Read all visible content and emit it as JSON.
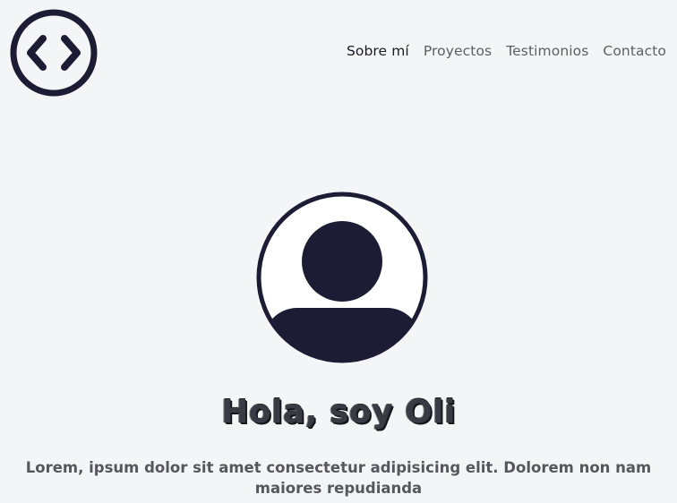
{
  "nav": {
    "items": [
      {
        "label": "Sobre mí"
      },
      {
        "label": "Proyectos"
      },
      {
        "label": "Testimonios"
      },
      {
        "label": "Contacto"
      }
    ]
  },
  "hero": {
    "title": "Hola, soy Oli",
    "text": "Lorem, ipsum dolor sit amet consectetur adipisicing elit. Dolorem non nam maiores repudianda"
  },
  "icons": {
    "logo": "code-brackets-icon",
    "avatar": "user-avatar-icon"
  },
  "colors": {
    "background": "#f4f5f7",
    "navy": "#1c1d35",
    "nav_active": "#1a1a24",
    "nav_inactive": "#5b5e66"
  }
}
